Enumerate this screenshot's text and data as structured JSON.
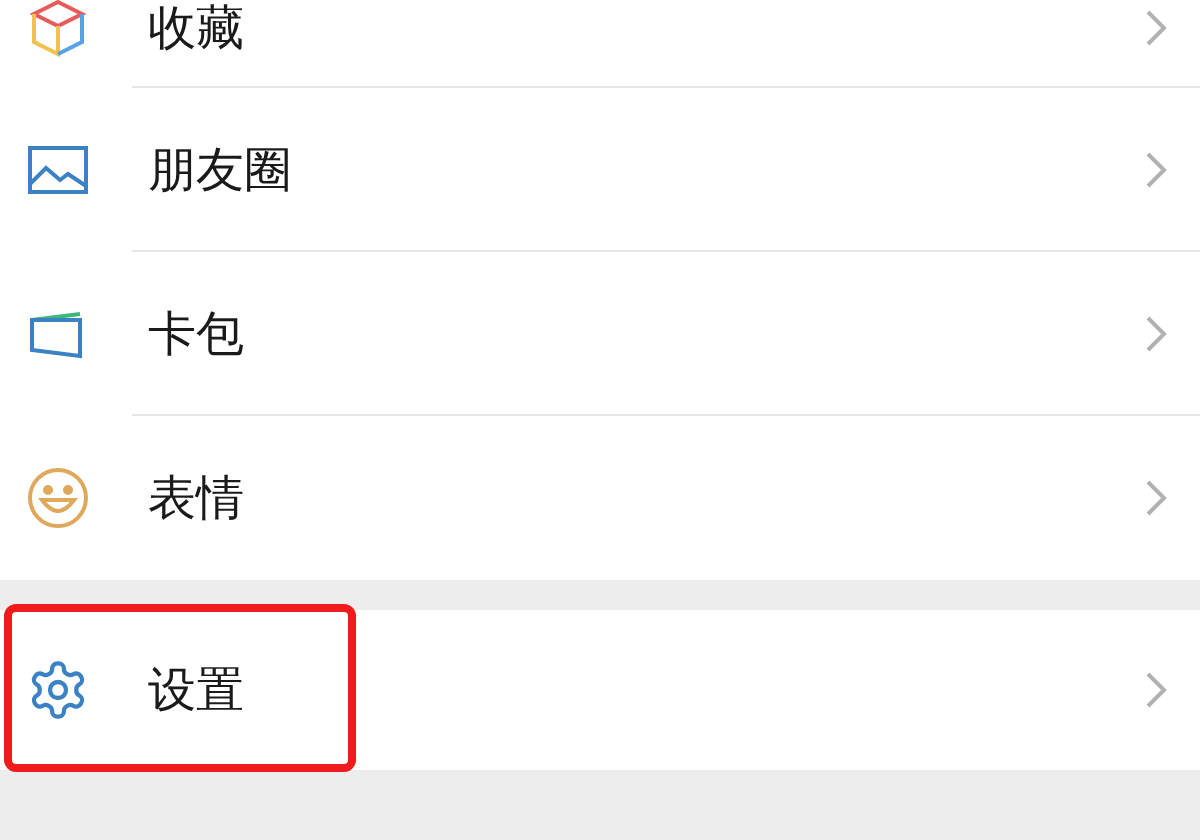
{
  "groups": [
    {
      "items": [
        {
          "kind": "favorites",
          "label": "收藏",
          "highlighted": false
        },
        {
          "kind": "moments",
          "label": "朋友圈",
          "highlighted": false
        },
        {
          "kind": "cards",
          "label": "卡包",
          "highlighted": false
        },
        {
          "kind": "stickers",
          "label": "表情",
          "highlighted": false
        }
      ]
    },
    {
      "items": [
        {
          "kind": "settings",
          "label": "设置",
          "highlighted": true
        }
      ]
    }
  ]
}
